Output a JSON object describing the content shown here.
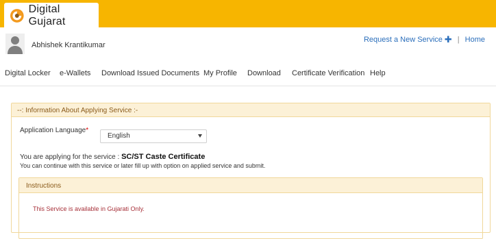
{
  "header": {
    "brand": "Digital Gujarat"
  },
  "user": {
    "name": "Abhishek Krantikumar"
  },
  "top_links": {
    "request_service": "Request a New Service",
    "separator": "|",
    "home": "Home"
  },
  "nav": [
    {
      "label": "Digital Locker"
    },
    {
      "label": "e-Wallets"
    },
    {
      "label": "Download Issued Documents"
    },
    {
      "label": "My Profile"
    },
    {
      "label": "Download"
    },
    {
      "label": "Certificate Verification"
    },
    {
      "label": "Help"
    }
  ],
  "panel": {
    "title": "--: Information About Applying Service :-",
    "language_label": "Application Language",
    "required_mark": "*",
    "language_value": "English",
    "service_prefix": "You are applying for the service :",
    "service_name": "SC/ST Caste Certificate",
    "service_note": "You can continue with this service or later fill up with option on applied service and submit."
  },
  "instructions": {
    "title": "Instructions",
    "message": "This Service is available in Gujarati Only."
  },
  "colors": {
    "brand_bar": "#f7b500",
    "link": "#2a6ebb",
    "panel_border": "#f0d79a",
    "panel_head_bg": "#fcf1d7",
    "notice_text": "#a7313a"
  },
  "icons": {
    "logo": "digital-gujarat-logo-icon",
    "avatar": "user-avatar-icon",
    "add": "plus-icon",
    "dropdown": "caret-down-icon"
  }
}
